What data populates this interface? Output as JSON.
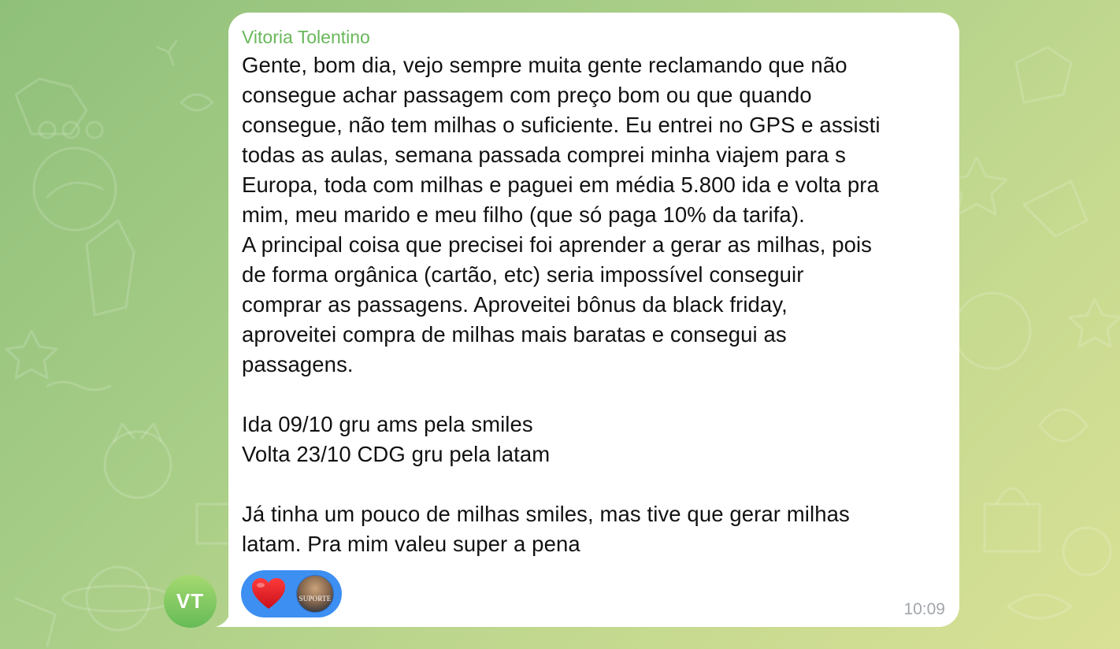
{
  "message": {
    "sender": "Vitoria Tolentino",
    "text": "Gente, bom dia, vejo sempre muita gente reclamando que não\nconsegue achar passagem com preço bom ou que quando\nconsegue, não tem milhas o suficiente. Eu entrei no GPS e assisti\ntodas as aulas, semana passada comprei minha viajem para s\nEuropa, toda com milhas e paguei em média 5.800 ida e volta pra\nmim, meu marido e meu filho (que só paga 10% da tarifa).\nA principal coisa que precisei foi aprender a gerar as milhas, pois\nde forma orgânica (cartão, etc) seria impossível conseguir\ncomprar as passagens. Aproveitei bônus da black friday,\naproveitei compra de milhas mais baratas e consegui as\npassagens.\n\nIda 09/10 gru ams pela smiles\nVolta 23/10 CDG gru pela latam\n\nJá tinha um pouco de milhas smiles, mas tive que gerar milhas\nlatam. Pra mim valeu super a pena",
    "time": "10:09",
    "avatar_initials": "VT",
    "reaction": {
      "emoji_icon": "heart-icon",
      "reactor_label": "SUPORTE"
    }
  },
  "colors": {
    "sender_name": "#68b85a",
    "bubble": "#ffffff",
    "reaction_pill": "#3d8ff2",
    "timestamp": "#a0a6ab",
    "avatar_top": "#a5d970",
    "avatar_bottom": "#66bb57",
    "wallpaper_start": "#8fc07a",
    "wallpaper_end": "#d9e196"
  }
}
